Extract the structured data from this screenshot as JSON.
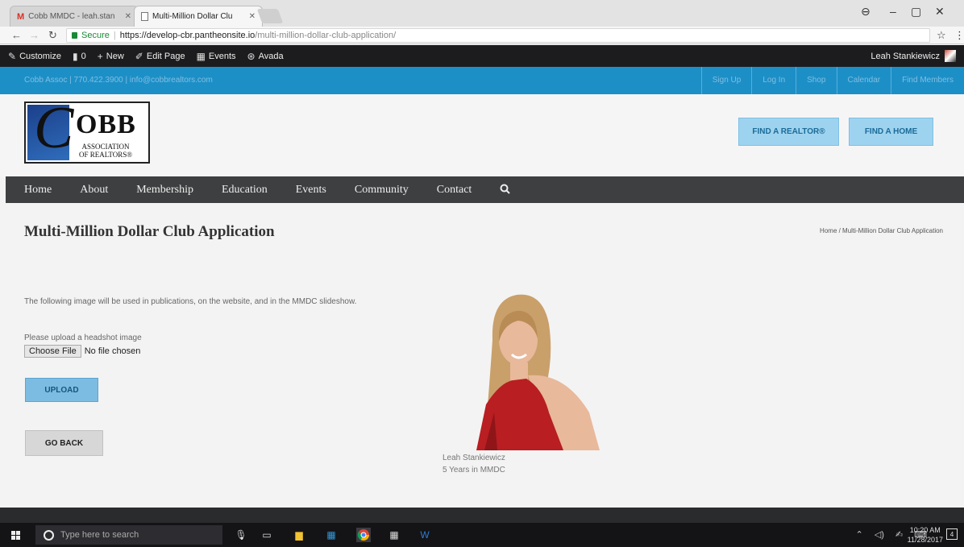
{
  "browser": {
    "tabs": [
      {
        "title": "Cobb MMDC - leah.stan",
        "active": false
      },
      {
        "title": "Multi-Million Dollar Clu",
        "active": true
      }
    ],
    "address": {
      "secure_label": "Secure",
      "host": "https://develop-cbr.pantheonsite.io",
      "path": "/multi-million-dollar-club-application/"
    }
  },
  "adminbar": {
    "items": [
      "Customize",
      "0",
      "New",
      "Edit Page",
      "Events",
      "Avada"
    ],
    "user": "Leah Stankiewicz"
  },
  "topbar": {
    "contact": "Cobb Assoc | 770.422.3900 | info@cobbrealtors.com",
    "links": [
      "Sign Up",
      "Log In",
      "Shop",
      "Calendar",
      "Find Members"
    ]
  },
  "header": {
    "logo": {
      "c": "C",
      "obb": "OBB",
      "assoc_line1": "ASSOCIATION",
      "assoc_line2": "OF REALTORS®"
    },
    "find_realtor": "FIND A REALTOR®",
    "find_home": "FIND A HOME"
  },
  "nav": [
    "Home",
    "About",
    "Membership",
    "Education",
    "Events",
    "Community",
    "Contact"
  ],
  "content": {
    "title": "Multi-Million Dollar Club Application",
    "breadcrumb": "Home / Multi-Million Dollar Club Application",
    "intro": "The following image will be used in publications, on the website, and in the MMDC slideshow.",
    "upload_label": "Please upload a headshot image",
    "choose_file": "Choose File",
    "no_file": "No file chosen",
    "upload_button": "UPLOAD",
    "back_button": "GO BACK",
    "caption_name": "Leah Stankiewicz",
    "caption_years": "5 Years in MMDC"
  },
  "taskbar": {
    "search_placeholder": "Type here to search",
    "time": "10:20 AM",
    "date": "11/28/2017"
  },
  "colors": {
    "topbar_blue": "#1d8fc7",
    "nav_dark": "#3d3f40",
    "button_blue": "#7dbce2"
  }
}
